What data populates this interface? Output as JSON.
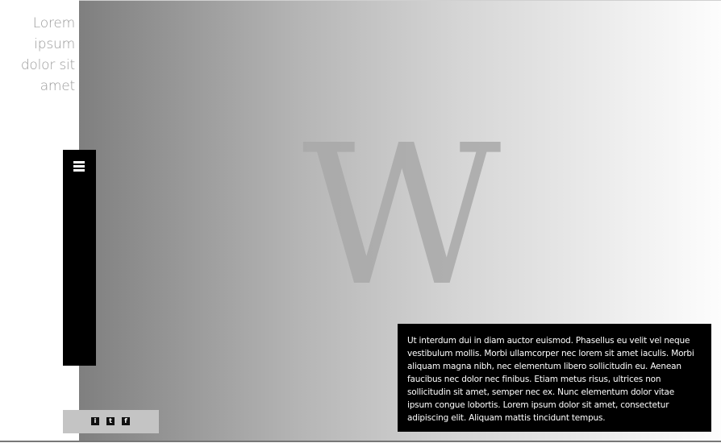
{
  "site": {
    "title": "Lorem ipsum dolor sit amet"
  },
  "hero": {
    "logo_letter": "W"
  },
  "menu": {
    "icon": "hamburger-menu-icon"
  },
  "social": {
    "icons": [
      {
        "name": "info-icon",
        "glyph": "i"
      },
      {
        "name": "twitter-icon",
        "glyph": "t"
      },
      {
        "name": "facebook-icon",
        "glyph": "f"
      }
    ]
  },
  "content": {
    "paragraph": "Ut interdum dui in diam auctor euismod. Phasellus eu velit vel neque vestibulum mollis. Morbi ullamcorper nec lorem sit amet iaculis. Morbi aliquam magna nibh, nec elementum libero sollicitudin eu. Aenean faucibus nec dolor nec finibus. Etiam metus risus, ultrices non sollicitudin sit amet, semper nec ex. Nunc elementum dolor vitae ipsum congue lobortis. Lorem ipsum dolor sit amet, consectetur adipiscing elit. Aliquam mattis tincidunt tempus."
  },
  "colors": {
    "panel": "#000000",
    "title_text": "#9a9a9a",
    "social_bar": "#c4c4c4"
  }
}
